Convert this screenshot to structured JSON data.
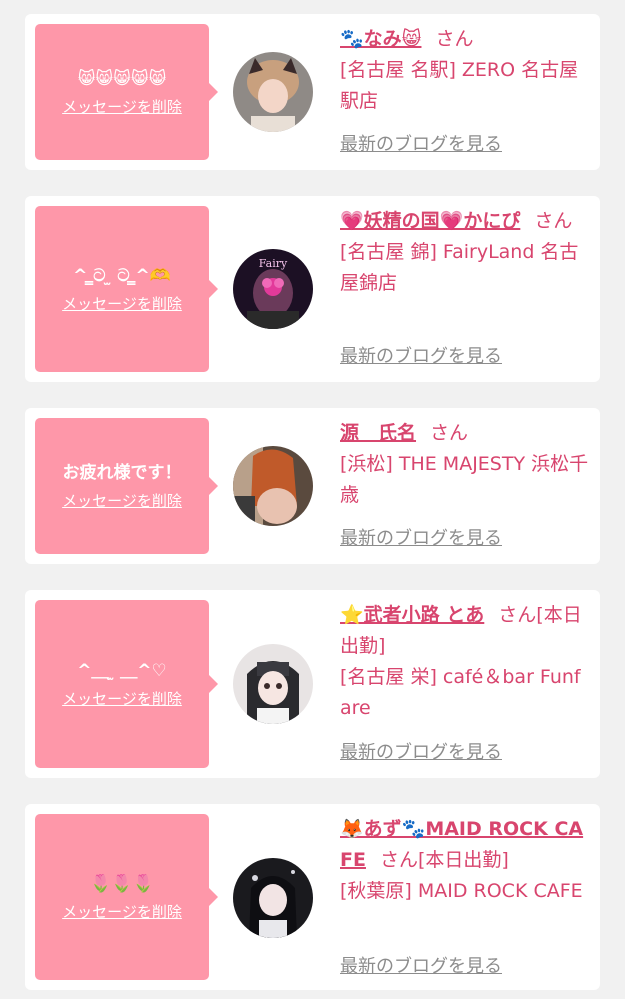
{
  "colors": {
    "page_background": "#f1f1f1",
    "card_background": "#ffffff",
    "bubble_pink": "#fe97a9",
    "accent_pink": "#d8456e",
    "link_gray": "#8c8c8c"
  },
  "cards": [
    {
      "message": "😸😸😸😸😸",
      "delete_label": "メッセージを削除",
      "name": "🐾なみ😸",
      "honorific": "さん",
      "badge": "",
      "shop": "[名古屋 名駅] ZERO 名古屋駅店",
      "blog_link": "最新のブログを見る",
      "avatar": "avatar-photo-1"
    },
    {
      "message": "^ ̳ට ̫ ට ̳^🫶",
      "delete_label": "メッセージを削除",
      "name": "💗妖精の国💗かにぴ",
      "honorific": "さん",
      "badge": "",
      "shop": "[名古屋 錦] FairyLand 名古屋錦店",
      "blog_link": "最新のブログを見る",
      "avatar": "avatar-photo-2"
    },
    {
      "message": "お疲れ様です！",
      "delete_label": "メッセージを削除",
      "name": "源　氏名",
      "honorific": "さん",
      "badge": "",
      "shop": "[浜松] THE MAJESTY 浜松千歳",
      "blog_link": "最新のブログを見る",
      "avatar": "avatar-photo-3"
    },
    {
      "message": "^＿ ̫ ＿^♡",
      "delete_label": "メッセージを削除",
      "name": "⭐武者小路 とあ",
      "honorific": "さん",
      "badge": "[本日出勤]",
      "shop": "[名古屋 栄] café＆bar Funfare",
      "blog_link": "最新のブログを見る",
      "avatar": "avatar-photo-4"
    },
    {
      "message": "🌷🌷🌷",
      "delete_label": "メッセージを削除",
      "name": "🦊あず🐾MAID ROCK CAFE",
      "honorific": "さん",
      "badge": "[本日出勤]",
      "shop": "[秋葉原] MAID ROCK CAFE",
      "blog_link": "最新のブログを見る",
      "avatar": "avatar-photo-5"
    }
  ]
}
